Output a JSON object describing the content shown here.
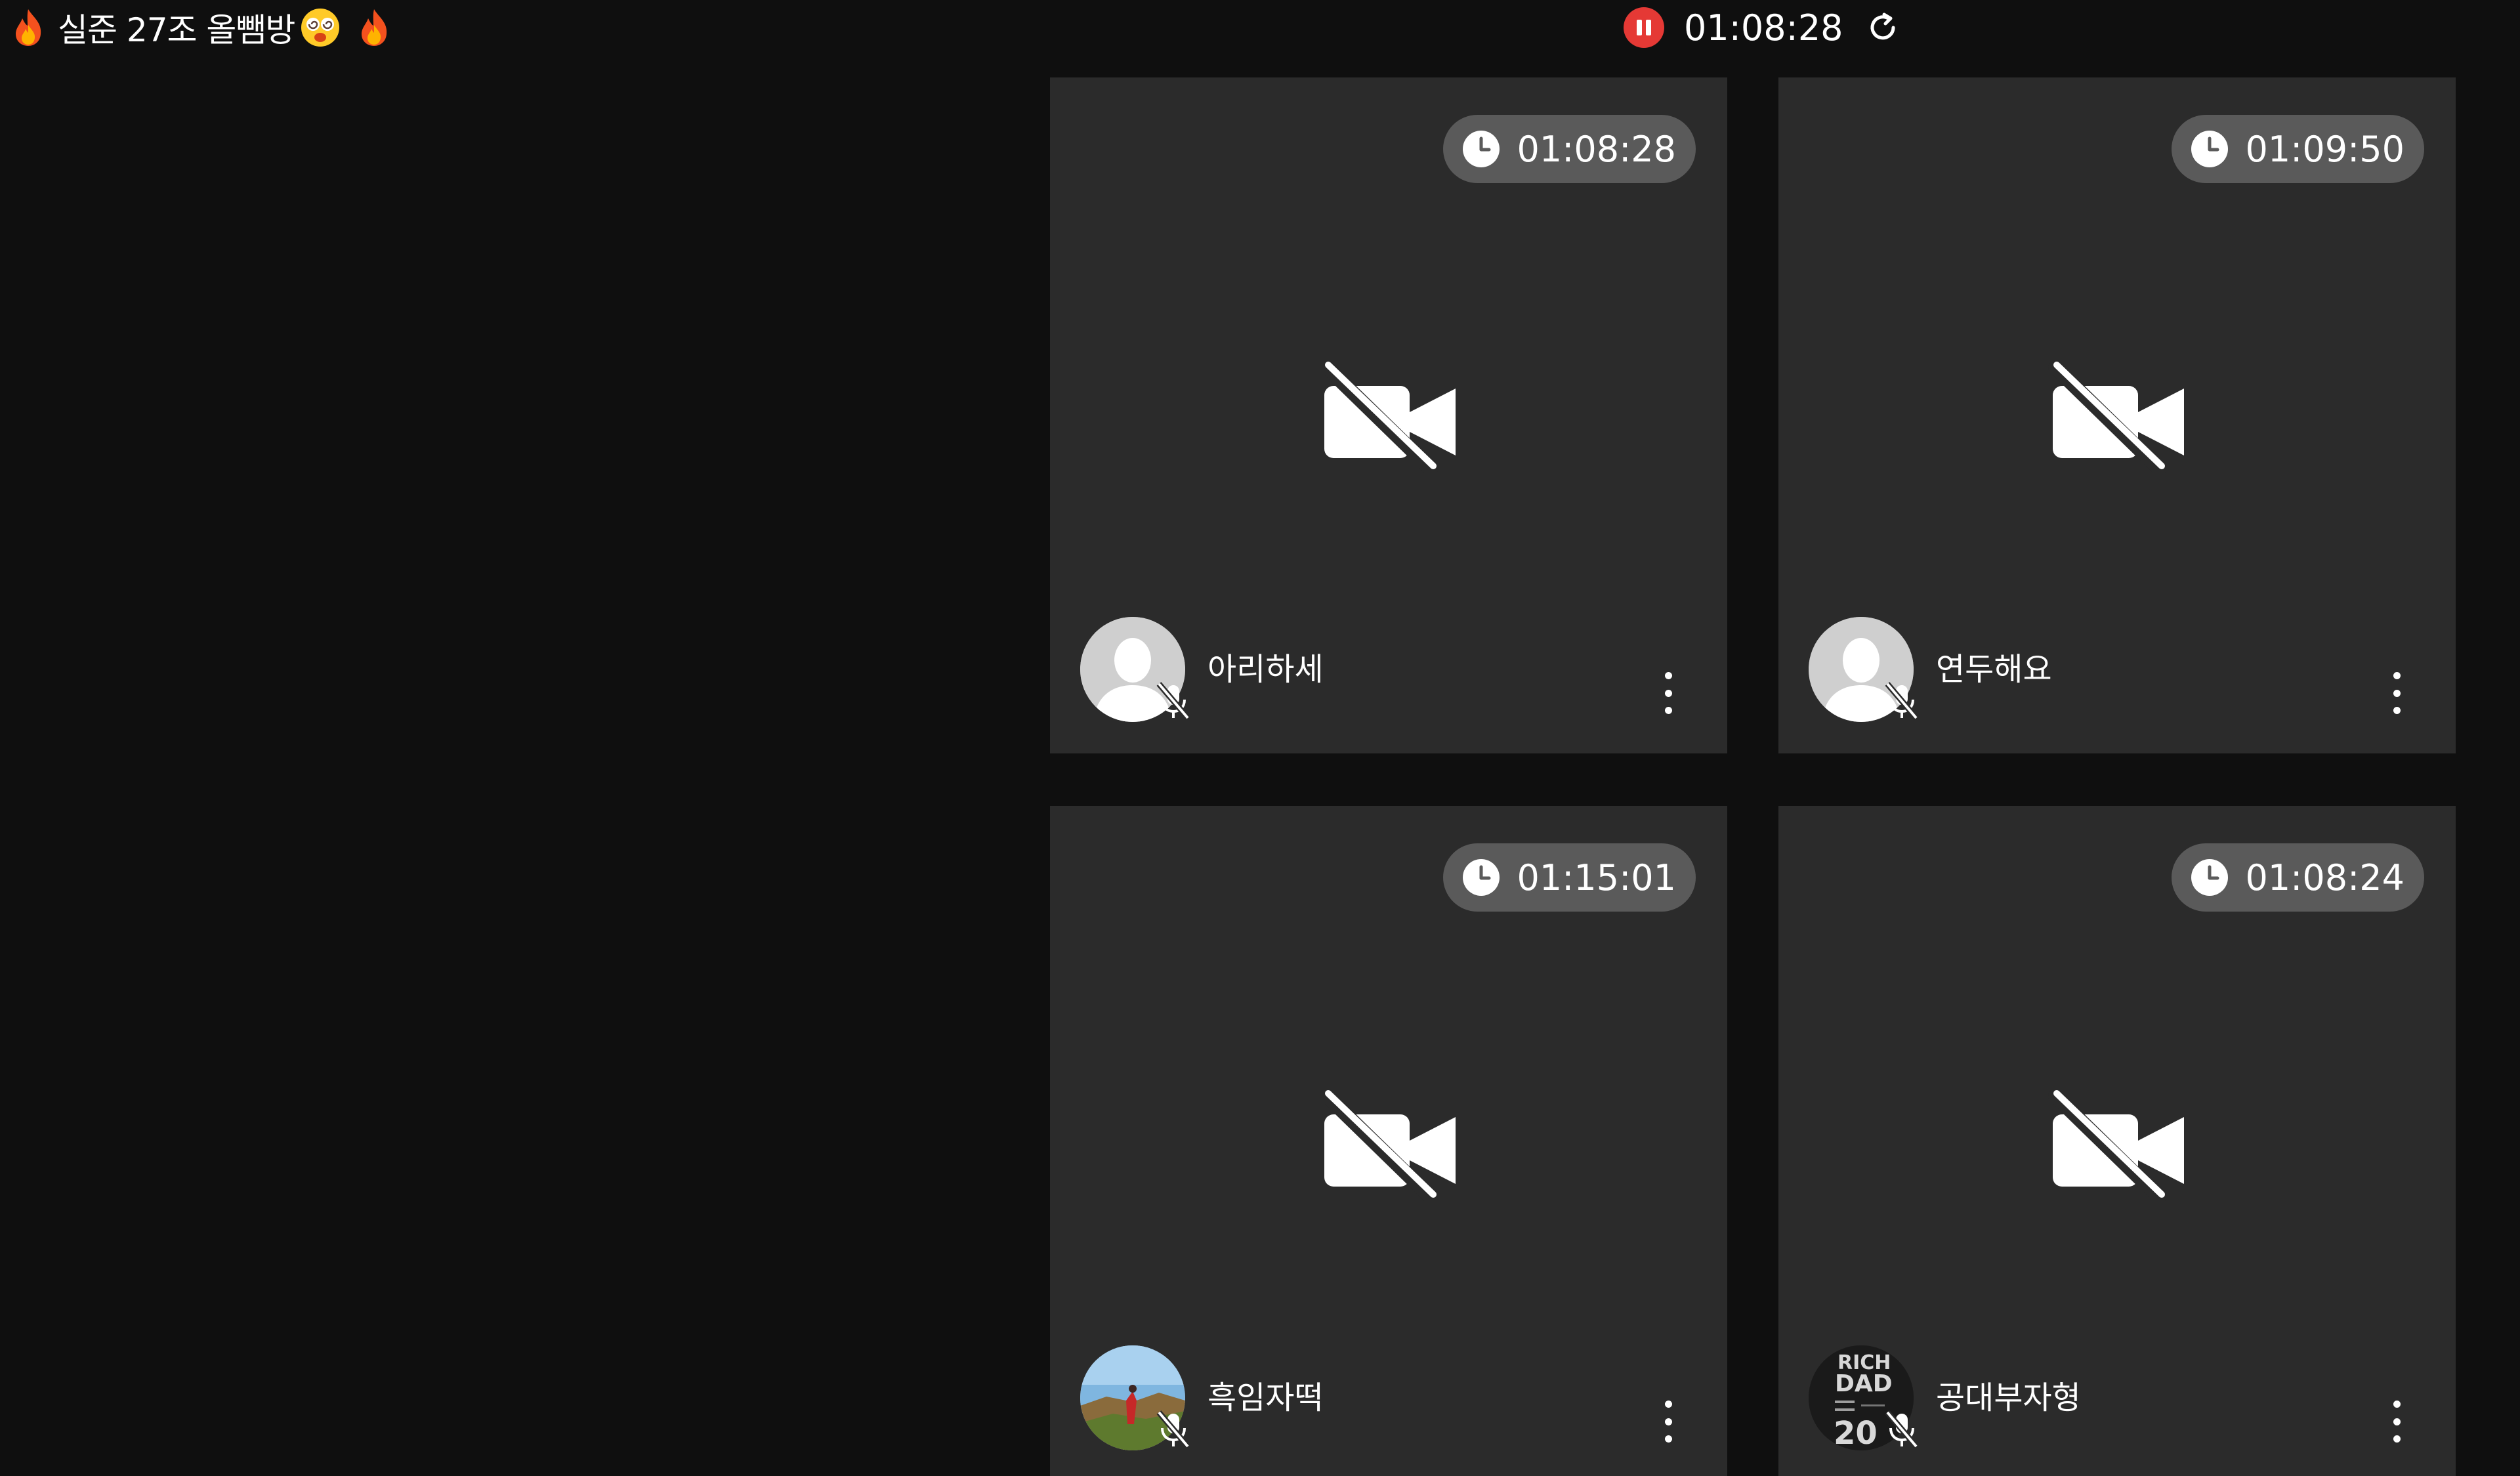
{
  "room": {
    "title": "실준 27조 올뺌방",
    "icons": [
      "fire-emoji",
      "dizzy-face-emoji",
      "fire-emoji"
    ]
  },
  "session": {
    "elapsed": "01:08:28",
    "status": "paused",
    "pause_color": "#e53935"
  },
  "participants": [
    {
      "name": "아리하세",
      "timer": "01:08:28",
      "avatar": "default-person",
      "camera": "off",
      "mic": "muted"
    },
    {
      "name": "연두해요",
      "timer": "01:09:50",
      "avatar": "default-person",
      "camera": "off",
      "mic": "muted"
    },
    {
      "name": "흑임자떡",
      "timer": "01:15:01",
      "avatar": "landscape-photo",
      "camera": "off",
      "mic": "muted"
    },
    {
      "name": "공대부자형",
      "timer": "01:08:24",
      "avatar": "book-cover",
      "avatar_text": [
        "RICH",
        "DAD",
        "20"
      ],
      "camera": "off",
      "mic": "muted"
    }
  ],
  "colors": {
    "background": "#0f0f0f",
    "tile": "#2b2b2b",
    "timer_pill": "#5a5a5a",
    "text": "#ffffff"
  }
}
